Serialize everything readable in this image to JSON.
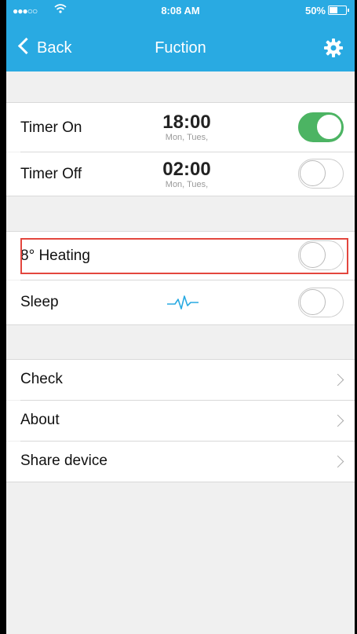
{
  "status_bar": {
    "signal": "●●●○○",
    "time": "8:08 AM",
    "battery": "50%",
    "battery_level": 0.5
  },
  "nav": {
    "back_label": "Back",
    "title": "Fuction",
    "settings_icon": "gear-icon"
  },
  "timers": [
    {
      "label": "Timer On",
      "time": "18:00",
      "days": "Mon, Tues,",
      "enabled": true
    },
    {
      "label": "Timer Off",
      "time": "02:00",
      "days": "Mon, Tues,",
      "enabled": false
    }
  ],
  "features": [
    {
      "label": "8° Heating",
      "enabled": false,
      "highlighted": true
    },
    {
      "label": "Sleep",
      "icon": "pulse-icon",
      "enabled": false
    }
  ],
  "menu": [
    {
      "label": "Check"
    },
    {
      "label": "About"
    },
    {
      "label": "Share device"
    }
  ],
  "colors": {
    "header": "#29aae2",
    "toggle_on": "#4cb463",
    "highlight": "#e3463e"
  }
}
